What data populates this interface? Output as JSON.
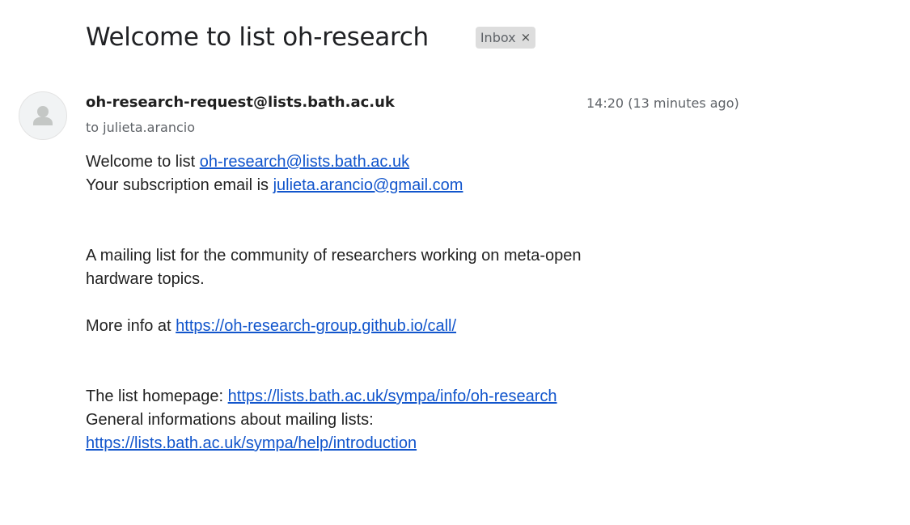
{
  "email": {
    "subject": "Welcome to list oh-research",
    "label": {
      "name": "Inbox",
      "close_glyph": "×"
    },
    "avatar_icon": "person-icon",
    "sender": "oh-research-request@lists.bath.ac.uk",
    "recipient": "to julieta.arancio",
    "timestamp": "14:20 (13 minutes ago)",
    "body": {
      "welcome_prefix": "Welcome to list ",
      "welcome_link": "oh-research@lists.bath.ac.uk",
      "subscription_prefix": "Your subscription email is ",
      "subscription_link": "julieta.arancio@gmail.com",
      "description": "A mailing list for the community of researchers working on meta-open hardware topics.",
      "more_info_prefix": "More info at ",
      "more_info_link": "https://oh-research-group.github.io/call/",
      "homepage_prefix": "The list homepage: ",
      "homepage_link": "https://lists.bath.ac.uk/sympa/info/oh-research",
      "general_info_label": "General informations about mailing lists:",
      "general_info_link": "https://lists.bath.ac.uk/sympa/help/introduction"
    }
  },
  "colors": {
    "link": "#1155cc",
    "chip_bg": "#dddddd",
    "muted_text": "#5f6368"
  }
}
